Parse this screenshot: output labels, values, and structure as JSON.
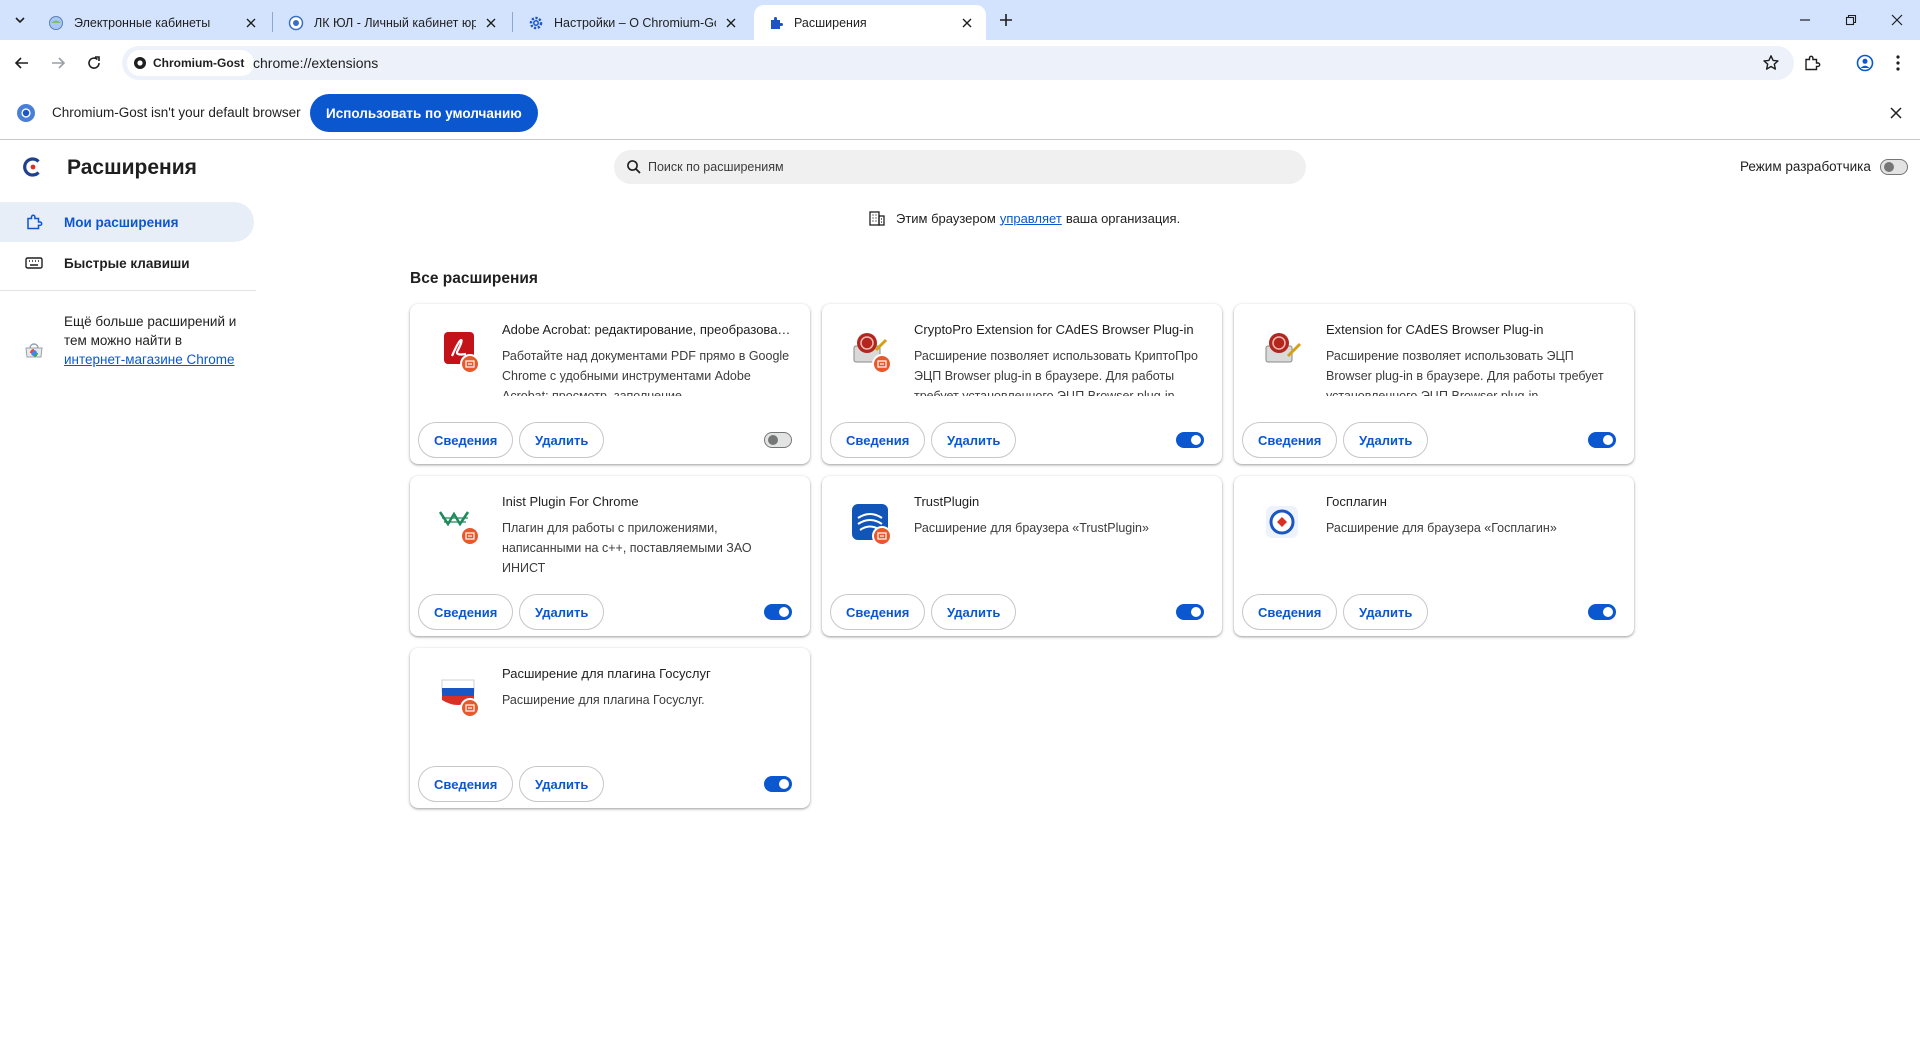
{
  "tabs": [
    {
      "title": "Электронные кабинеты",
      "icon": "globe-icon",
      "active": false
    },
    {
      "title": "ЛК ЮЛ - Личный кабинет юридического лица",
      "icon": "globe-icon",
      "active": false
    },
    {
      "title": "Настройки – О Chromium-Gost",
      "icon": "gear-icon",
      "active": false
    },
    {
      "title": "Расширения",
      "icon": "puzzle-icon",
      "active": true
    }
  ],
  "omnibox": {
    "site_chip": "Chromium-Gost",
    "url": "chrome://extensions"
  },
  "infobar": {
    "message": "Chromium-Gost isn't your default browser",
    "button": "Использовать по умолчанию"
  },
  "header": {
    "title": "Расширения",
    "search_placeholder": "Поиск по расширениям",
    "dev_mode_label": "Режим разработчика",
    "dev_mode_on": false
  },
  "sidebar": {
    "items": [
      {
        "label": "Мои расширения",
        "icon": "puzzle-icon",
        "active": true
      },
      {
        "label": "Быстрые клавиши",
        "icon": "keyboard-icon",
        "active": false
      }
    ],
    "more_text": "Ещё больше расширений и тем можно найти в",
    "more_link": "интернет-магазине Chrome"
  },
  "managed": {
    "before": "Этим браузером",
    "link": "управляет",
    "after": "ваша организация."
  },
  "section_title": "Все расширения",
  "buttons": {
    "details": "Сведения",
    "remove": "Удалить"
  },
  "extensions": [
    {
      "name": "Adobe Acrobat: редактирование, преобразование и подписание PDF-файлов",
      "description": "Работайте над документами PDF прямо в Google Chrome с удобными инструментами Adobe Acrobat: просмотр, заполнение, комментирование",
      "enabled": false,
      "icon": "acrobat-icon"
    },
    {
      "name": "CryptoPro Extension for CAdES Browser Plug-in",
      "description": "Расширение позволяет использовать КриптоПро ЭЦП Browser plug-in в браузере. Для работы требует установленного ЭЦП Browser plug-in",
      "enabled": true,
      "icon": "cryptopro-icon"
    },
    {
      "name": "Extension for CAdES Browser Plug-in",
      "description": "Расширение позволяет использовать ЭЦП Browser plug-in в браузере. Для работы требует установленного ЭЦП Browser plug-in.",
      "enabled": true,
      "icon": "cades-icon"
    },
    {
      "name": "Inist Plugin For Chrome",
      "description": "Плагин для работы с приложениями, написанными на c++, поставляемыми ЗАО ИНИСТ",
      "enabled": true,
      "icon": "inist-icon"
    },
    {
      "name": "TrustPlugin",
      "description": "Расширение для браузера «TrustPlugin»",
      "enabled": true,
      "icon": "trustplugin-icon"
    },
    {
      "name": "Госплагин",
      "description": "Расширение для браузера «Госплагин»",
      "enabled": true,
      "icon": "gosplugin-icon"
    },
    {
      "name": "Расширение для плагина Госуслуг",
      "description": "Расширение для плагина Госуслуг.",
      "enabled": true,
      "icon": "gosuslugi-icon"
    }
  ]
}
